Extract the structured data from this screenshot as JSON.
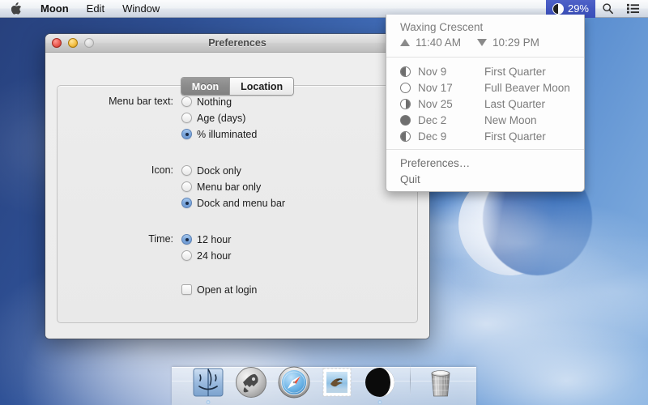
{
  "menubar": {
    "apple_icon": "apple-logo-icon",
    "items": [
      {
        "label": "Moon",
        "bold": true
      },
      {
        "label": "Edit",
        "bold": false
      },
      {
        "label": "Window",
        "bold": false
      }
    ],
    "status": {
      "moon_icon": "moon-phase-icon",
      "illumination": "29%",
      "search_icon": "search-icon",
      "notification_icon": "notification-center-icon",
      "highlight_color": "#4256c0"
    }
  },
  "dropdown": {
    "phase_name": "Waxing Crescent",
    "moonrise_icon": "triangle-up-icon",
    "moonrise": "11:40 AM",
    "moonset_icon": "triangle-down-icon",
    "moonset": "10:29 PM",
    "phases": [
      {
        "icon": "moon-first-quarter-icon",
        "date": "Nov 9",
        "name": "First Quarter"
      },
      {
        "icon": "moon-full-icon",
        "date": "Nov 17",
        "name": "Full Beaver Moon"
      },
      {
        "icon": "moon-last-quarter-icon",
        "date": "Nov 25",
        "name": "Last Quarter"
      },
      {
        "icon": "moon-new-icon",
        "date": "Dec 2",
        "name": "New Moon"
      },
      {
        "icon": "moon-first-quarter-icon",
        "date": "Dec 9",
        "name": "First Quarter"
      }
    ],
    "actions": [
      {
        "label": "Preferences…"
      },
      {
        "label": "Quit"
      }
    ]
  },
  "prefs_window": {
    "title": "Preferences",
    "traffic_lights": {
      "close": "close-button",
      "minimize": "minimize-button",
      "zoom": "zoom-button"
    },
    "tabs": [
      {
        "label": "Moon",
        "selected": true
      },
      {
        "label": "Location",
        "selected": false
      }
    ],
    "fields": [
      {
        "label": "Menu bar text:",
        "type": "radio",
        "options": [
          {
            "label": "Nothing",
            "selected": false
          },
          {
            "label": "Age (days)",
            "selected": false
          },
          {
            "label": "% illuminated",
            "selected": true
          }
        ]
      },
      {
        "label": "Icon:",
        "type": "radio",
        "options": [
          {
            "label": "Dock only",
            "selected": false
          },
          {
            "label": "Menu bar only",
            "selected": false
          },
          {
            "label": "Dock and menu bar",
            "selected": true
          }
        ]
      },
      {
        "label": "Time:",
        "type": "radio",
        "options": [
          {
            "label": "12 hour",
            "selected": true
          },
          {
            "label": "24 hour",
            "selected": false
          }
        ]
      }
    ],
    "checkbox": {
      "label": "Open at login",
      "checked": false
    }
  },
  "dock": {
    "items": [
      {
        "name": "finder-icon",
        "label": "Finder",
        "running": true
      },
      {
        "name": "launchpad-icon",
        "label": "Launchpad",
        "running": false
      },
      {
        "name": "safari-icon",
        "label": "Safari",
        "running": false
      },
      {
        "name": "mail-icon",
        "label": "Mail",
        "running": false
      },
      {
        "name": "moon-app-icon",
        "label": "Moon",
        "running": true
      },
      {
        "name": "trash-icon",
        "label": "Trash",
        "running": false
      }
    ]
  },
  "desktop": {
    "wallpaper": "blue-sky-with-crescent-moon",
    "sky_color": "#3f6ab5"
  }
}
